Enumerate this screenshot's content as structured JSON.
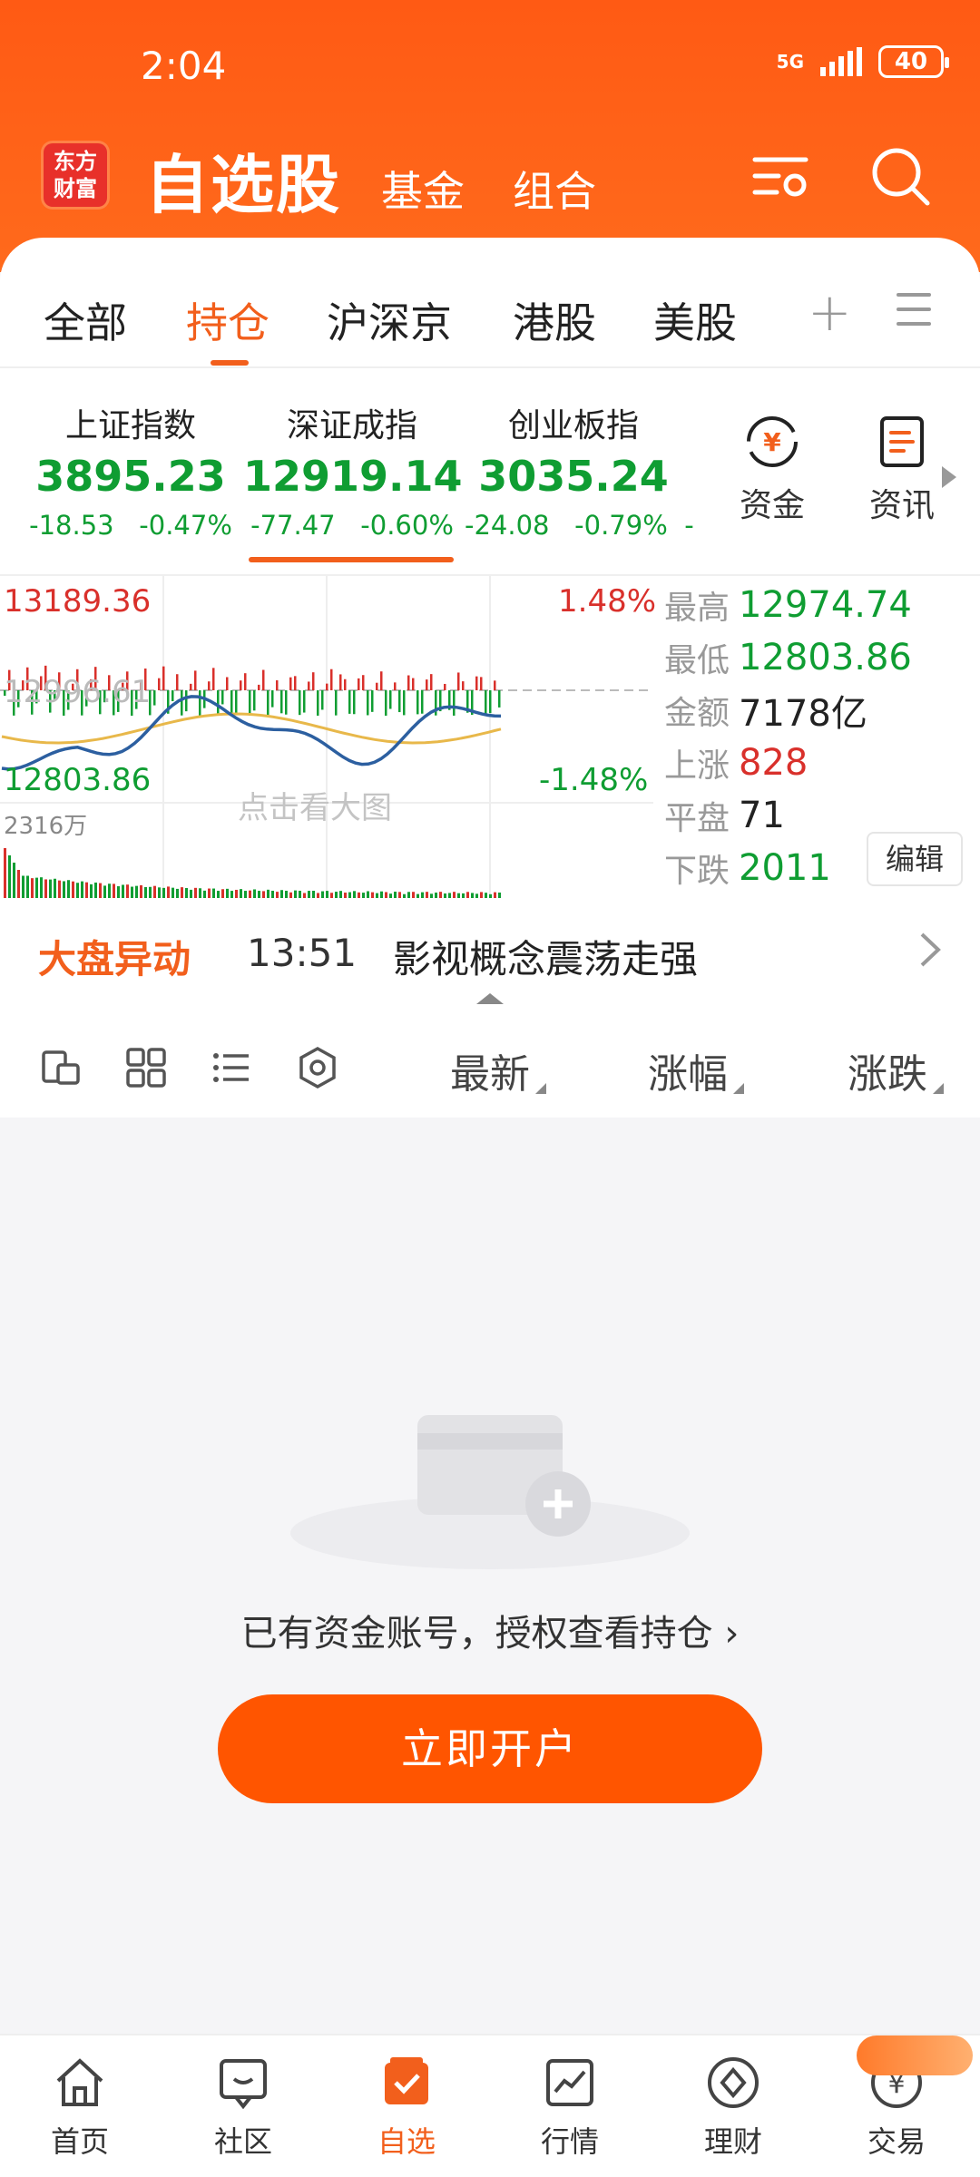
{
  "status_bar": {
    "time": "2:04",
    "network": "5G",
    "battery": "40"
  },
  "header": {
    "logo": [
      "东方",
      "财富"
    ],
    "title": "自选股",
    "subtabs": [
      "基金",
      "组合"
    ]
  },
  "tabs": {
    "items": [
      {
        "label": "全部"
      },
      {
        "label": "持仓"
      },
      {
        "label": "沪深京"
      },
      {
        "label": "港股"
      },
      {
        "label": "美股"
      }
    ],
    "active": "持仓"
  },
  "indices": [
    {
      "name": "上证指数",
      "value": "3895.23",
      "change": "-18.53",
      "pct": "-0.47%"
    },
    {
      "name": "深证成指",
      "value": "12919.14",
      "change": "-77.47",
      "pct": "-0.60%"
    },
    {
      "name": "创业板指",
      "value": "3035.24",
      "change": "-24.08",
      "pct": "-0.79%",
      "suffix": "-"
    }
  ],
  "side_buttons": [
    {
      "label": "资金"
    },
    {
      "label": "资讯"
    }
  ],
  "chart": {
    "top_left": "13189.36",
    "top_right": "1.48%",
    "bottom_left": "12803.86",
    "bottom_right": "-1.48%",
    "mid_label": "12996.61",
    "volume": "2316万",
    "overlay": "点击看大图"
  },
  "stats": {
    "high_label": "最高",
    "high": "12974.74",
    "low_label": "最低",
    "low": "12803.86",
    "amount_label": "金额",
    "amount": "7178亿",
    "up_label": "上涨",
    "up": "828",
    "flat_label": "平盘",
    "flat": "71",
    "down_label": "下跌",
    "down": "2011",
    "edit": "编辑"
  },
  "alert": {
    "tag": "大盘异动",
    "time": "13:51",
    "text": "影视概念震荡走强"
  },
  "toolbar": {
    "sort": [
      "最新",
      "涨幅",
      "涨跌"
    ]
  },
  "empty": {
    "text": "已有资金账号，授权查看持仓",
    "button": "立即开户"
  },
  "bottom_nav": [
    {
      "label": "首页"
    },
    {
      "label": "社区"
    },
    {
      "label": "自选"
    },
    {
      "label": "行情"
    },
    {
      "label": "理财"
    },
    {
      "label": "交易"
    }
  ],
  "colors": {
    "brand": "#ff5a14",
    "up": "#d9302b",
    "down": "#0f9d32"
  }
}
